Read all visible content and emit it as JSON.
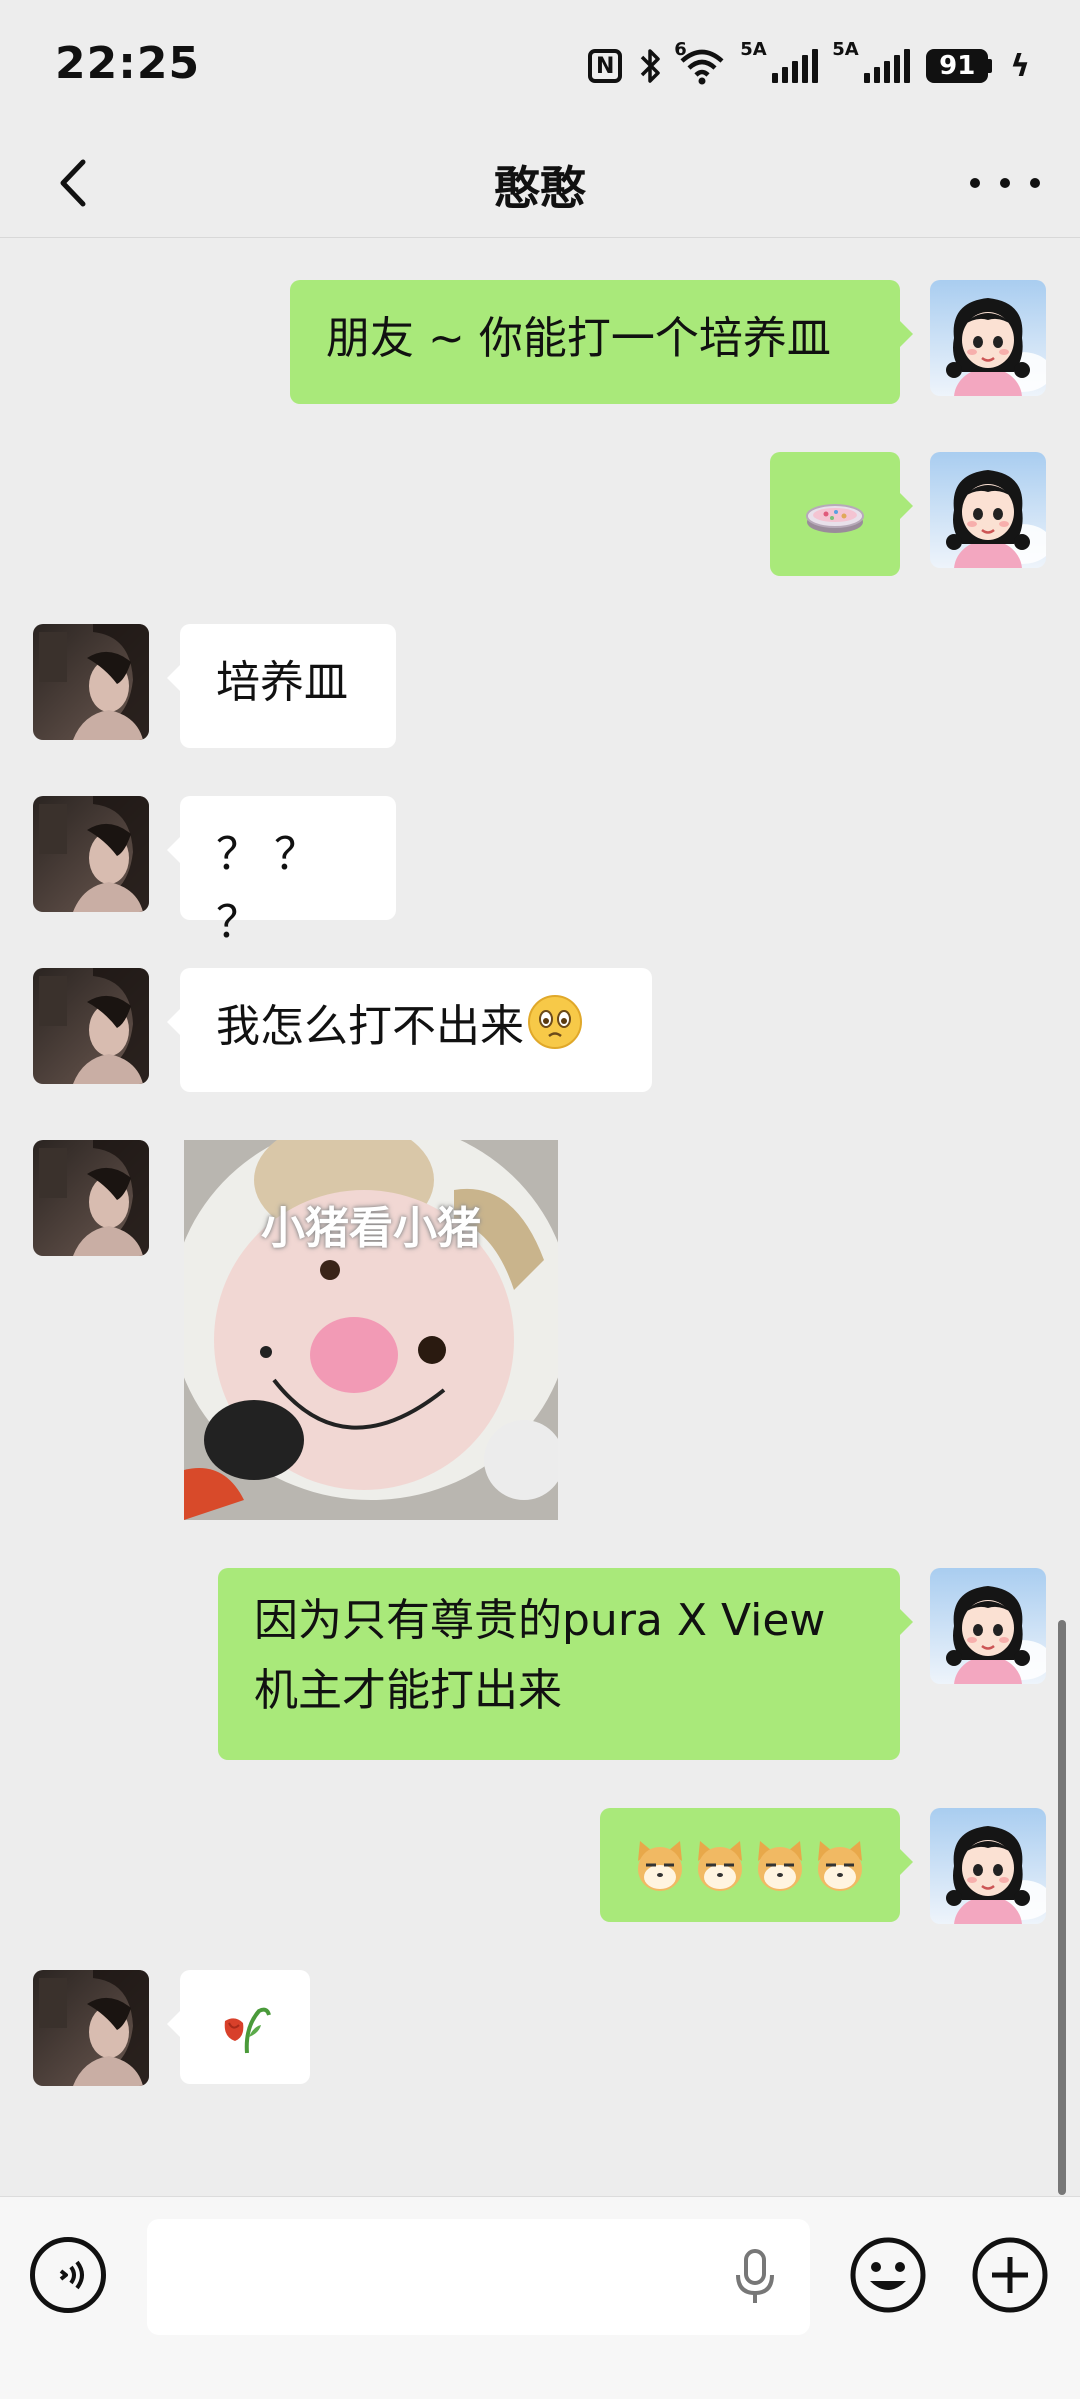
{
  "status_bar": {
    "time": "22:25",
    "nfc_label": "N",
    "wifi_label": "6",
    "sim1_label": "5A",
    "sim2_label": "5A",
    "battery": "91"
  },
  "header": {
    "title": "憨憨"
  },
  "messages": [
    {
      "from": "self",
      "type": "text",
      "text": "朋友 ~ 你能打一个培养皿"
    },
    {
      "from": "self",
      "type": "emoji",
      "icon": "petri-dish-emoji"
    },
    {
      "from": "other",
      "type": "text",
      "text": "培养皿"
    },
    {
      "from": "other",
      "type": "text",
      "text": "？ ？ ？"
    },
    {
      "from": "other",
      "type": "text",
      "text": "我怎么打不出来"
    },
    {
      "from": "other",
      "type": "sticker",
      "caption": "小猪看小猪"
    },
    {
      "from": "self",
      "type": "text",
      "text_line1": "因为只有尊贵的pura X View",
      "text_line2": "机主才能打出来"
    },
    {
      "from": "self",
      "type": "emoji",
      "icon": "doge-emoji x4"
    },
    {
      "from": "other",
      "type": "emoji",
      "icon": "wilted-rose-emoji"
    }
  ],
  "input_bar": {
    "placeholder": ""
  },
  "colors": {
    "self_bubble": "#a9e97a",
    "other_bubble": "#ffffff",
    "background": "#ededed"
  }
}
